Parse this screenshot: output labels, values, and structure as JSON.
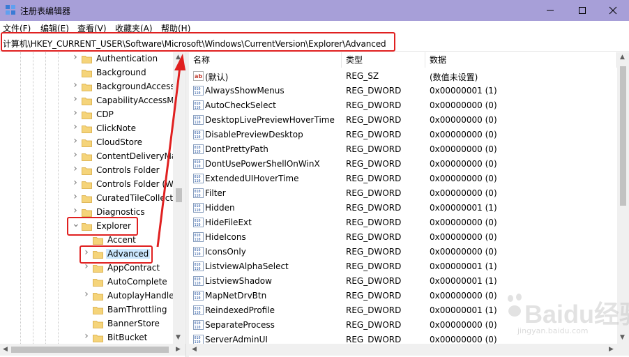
{
  "window": {
    "title": "注册表编辑器"
  },
  "menu": [
    "文件(F)",
    "编辑(E)",
    "查看(V)",
    "收藏夹(A)",
    "帮助(H)"
  ],
  "address": "计算机\\HKEY_CURRENT_USER\\Software\\Microsoft\\Windows\\CurrentVersion\\Explorer\\Advanced",
  "tree": [
    {
      "label": "Authentication",
      "level": 1,
      "expander": "collapsed"
    },
    {
      "label": "Background",
      "level": 1,
      "expander": "none"
    },
    {
      "label": "BackgroundAccess",
      "level": 1,
      "expander": "collapsed"
    },
    {
      "label": "CapabilityAccessM",
      "level": 1,
      "expander": "collapsed"
    },
    {
      "label": "CDP",
      "level": 1,
      "expander": "collapsed"
    },
    {
      "label": "ClickNote",
      "level": 1,
      "expander": "collapsed"
    },
    {
      "label": "CloudStore",
      "level": 1,
      "expander": "collapsed"
    },
    {
      "label": "ContentDeliveryMa",
      "level": 1,
      "expander": "collapsed"
    },
    {
      "label": "Controls Folder",
      "level": 1,
      "expander": "collapsed"
    },
    {
      "label": "Controls Folder (W",
      "level": 1,
      "expander": "collapsed"
    },
    {
      "label": "CuratedTileCollecti",
      "level": 1,
      "expander": "collapsed"
    },
    {
      "label": "Diagnostics",
      "level": 1,
      "expander": "collapsed"
    },
    {
      "label": "Explorer",
      "level": 1,
      "expander": "expanded"
    },
    {
      "label": "Accent",
      "level": 2,
      "expander": "none"
    },
    {
      "label": "Advanced",
      "level": 2,
      "expander": "collapsed",
      "selected": true
    },
    {
      "label": "AppContract",
      "level": 2,
      "expander": "collapsed"
    },
    {
      "label": "AutoComplete",
      "level": 2,
      "expander": "none"
    },
    {
      "label": "AutoplayHandle",
      "level": 2,
      "expander": "collapsed"
    },
    {
      "label": "BamThrottling",
      "level": 2,
      "expander": "none"
    },
    {
      "label": "BannerStore",
      "level": 2,
      "expander": "none"
    },
    {
      "label": "BitBucket",
      "level": 2,
      "expander": "collapsed"
    }
  ],
  "columns": {
    "name": "名称",
    "type": "类型",
    "data": "数据"
  },
  "values": [
    {
      "name": "(默认)",
      "type": "REG_SZ",
      "data": "(数值未设置)",
      "icon": "string"
    },
    {
      "name": "AlwaysShowMenus",
      "type": "REG_DWORD",
      "data": "0x00000001 (1)",
      "icon": "binary"
    },
    {
      "name": "AutoCheckSelect",
      "type": "REG_DWORD",
      "data": "0x00000000 (0)",
      "icon": "binary"
    },
    {
      "name": "DesktopLivePreviewHoverTime",
      "type": "REG_DWORD",
      "data": "0x00000000 (0)",
      "icon": "binary"
    },
    {
      "name": "DisablePreviewDesktop",
      "type": "REG_DWORD",
      "data": "0x00000000 (0)",
      "icon": "binary"
    },
    {
      "name": "DontPrettyPath",
      "type": "REG_DWORD",
      "data": "0x00000000 (0)",
      "icon": "binary"
    },
    {
      "name": "DontUsePowerShellOnWinX",
      "type": "REG_DWORD",
      "data": "0x00000000 (0)",
      "icon": "binary"
    },
    {
      "name": "ExtendedUIHoverTime",
      "type": "REG_DWORD",
      "data": "0x00000000 (0)",
      "icon": "binary"
    },
    {
      "name": "Filter",
      "type": "REG_DWORD",
      "data": "0x00000000 (0)",
      "icon": "binary"
    },
    {
      "name": "Hidden",
      "type": "REG_DWORD",
      "data": "0x00000001 (1)",
      "icon": "binary"
    },
    {
      "name": "HideFileExt",
      "type": "REG_DWORD",
      "data": "0x00000000 (0)",
      "icon": "binary"
    },
    {
      "name": "HideIcons",
      "type": "REG_DWORD",
      "data": "0x00000000 (0)",
      "icon": "binary"
    },
    {
      "name": "IconsOnly",
      "type": "REG_DWORD",
      "data": "0x00000000 (0)",
      "icon": "binary"
    },
    {
      "name": "ListviewAlphaSelect",
      "type": "REG_DWORD",
      "data": "0x00000001 (1)",
      "icon": "binary"
    },
    {
      "name": "ListviewShadow",
      "type": "REG_DWORD",
      "data": "0x00000001 (1)",
      "icon": "binary"
    },
    {
      "name": "MapNetDrvBtn",
      "type": "REG_DWORD",
      "data": "0x00000000 (0)",
      "icon": "binary"
    },
    {
      "name": "ReindexedProfile",
      "type": "REG_DWORD",
      "data": "0x00000001 (1)",
      "icon": "binary"
    },
    {
      "name": "SeparateProcess",
      "type": "REG_DWORD",
      "data": "0x00000000 (0)",
      "icon": "binary"
    },
    {
      "name": "ServerAdminUI",
      "type": "REG_DWORD",
      "data": "0x00000000 (0)",
      "icon": "binary"
    }
  ],
  "watermark": {
    "text": "Baidu经验",
    "sub": "jingyan.baidu.com"
  },
  "colors": {
    "titlebar": "#a79fd8",
    "annotation": "#e02020",
    "folder": "#f5d47a",
    "selection": "#cce8ff"
  }
}
